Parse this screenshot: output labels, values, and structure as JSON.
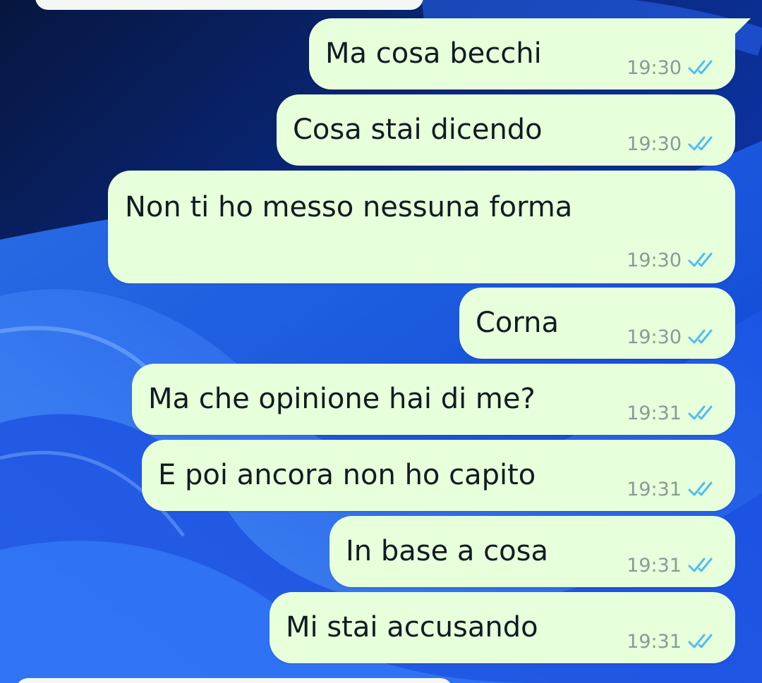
{
  "chat": {
    "accent": "#53bdeb",
    "bubble_color": "#e7ffdb",
    "messages": [
      {
        "text": "Ma cosa becchi",
        "time": "19:30",
        "status": "read-double-check-icon"
      },
      {
        "text": "Cosa stai dicendo",
        "time": "19:30",
        "status": "read-double-check-icon"
      },
      {
        "text": "Non ti ho messo nessuna forma",
        "time": "19:30",
        "status": "read-double-check-icon"
      },
      {
        "text": "Corna",
        "time": "19:30",
        "status": "read-double-check-icon"
      },
      {
        "text": "Ma che opinione hai di me?",
        "time": "19:31",
        "status": "read-double-check-icon"
      },
      {
        "text": "E poi ancora non ho capito",
        "time": "19:31",
        "status": "read-double-check-icon"
      },
      {
        "text": "In base a cosa",
        "time": "19:31",
        "status": "read-double-check-icon"
      },
      {
        "text": "Mi stai accusando",
        "time": "19:31",
        "status": "read-double-check-icon"
      }
    ]
  }
}
